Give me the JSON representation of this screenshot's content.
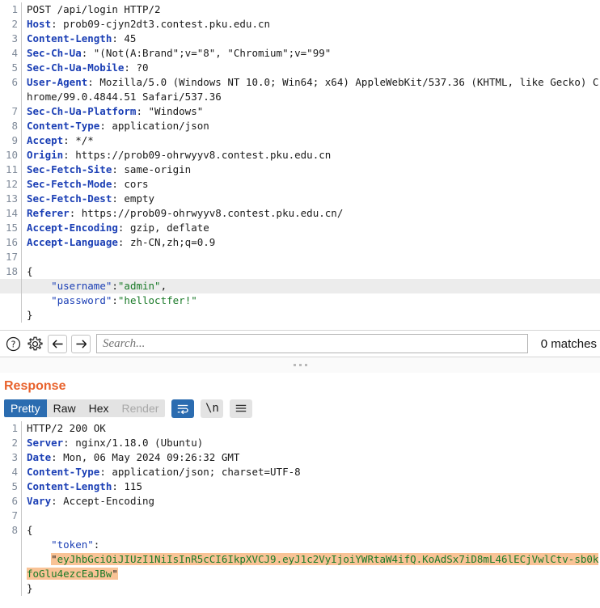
{
  "request": {
    "lines": [
      {
        "n": "1",
        "segments": [
          {
            "t": "POST /api/login HTTP/2",
            "c": "plain"
          }
        ]
      },
      {
        "n": "2",
        "segments": [
          {
            "t": "Host",
            "c": "hdr"
          },
          {
            "t": ": prob09-cjyn2dt3.contest.pku.edu.cn",
            "c": "plain"
          }
        ]
      },
      {
        "n": "3",
        "segments": [
          {
            "t": "Content-Length",
            "c": "hdr"
          },
          {
            "t": ": 45",
            "c": "plain"
          }
        ]
      },
      {
        "n": "4",
        "segments": [
          {
            "t": "Sec-Ch-Ua",
            "c": "hdr"
          },
          {
            "t": ": \"(Not(A:Brand\";v=\"8\", \"Chromium\";v=\"99\"",
            "c": "plain"
          }
        ]
      },
      {
        "n": "5",
        "segments": [
          {
            "t": "Sec-Ch-Ua-Mobile",
            "c": "hdr"
          },
          {
            "t": ": ?0",
            "c": "plain"
          }
        ]
      },
      {
        "n": "6",
        "segments": [
          {
            "t": "User-Agent",
            "c": "hdr"
          },
          {
            "t": ": Mozilla/5.0 (Windows NT 10.0; Win64; x64) AppleWebKit/537.36 (KHTML, like Gecko) Chrome/99.0.4844.51 Safari/537.36",
            "c": "plain"
          }
        ]
      },
      {
        "n": "7",
        "segments": [
          {
            "t": "Sec-Ch-Ua-Platform",
            "c": "hdr"
          },
          {
            "t": ": \"Windows\"",
            "c": "plain"
          }
        ]
      },
      {
        "n": "8",
        "segments": [
          {
            "t": "Content-Type",
            "c": "hdr"
          },
          {
            "t": ": application/json",
            "c": "plain"
          }
        ]
      },
      {
        "n": "9",
        "segments": [
          {
            "t": "Accept",
            "c": "hdr"
          },
          {
            "t": ": */*",
            "c": "plain"
          }
        ]
      },
      {
        "n": "10",
        "segments": [
          {
            "t": "Origin",
            "c": "hdr"
          },
          {
            "t": ": https://prob09-ohrwyyv8.contest.pku.edu.cn",
            "c": "plain"
          }
        ]
      },
      {
        "n": "11",
        "segments": [
          {
            "t": "Sec-Fetch-Site",
            "c": "hdr"
          },
          {
            "t": ": same-origin",
            "c": "plain"
          }
        ]
      },
      {
        "n": "12",
        "segments": [
          {
            "t": "Sec-Fetch-Mode",
            "c": "hdr"
          },
          {
            "t": ": cors",
            "c": "plain"
          }
        ]
      },
      {
        "n": "13",
        "segments": [
          {
            "t": "Sec-Fetch-Dest",
            "c": "hdr"
          },
          {
            "t": ": empty",
            "c": "plain"
          }
        ]
      },
      {
        "n": "14",
        "segments": [
          {
            "t": "Referer",
            "c": "hdr"
          },
          {
            "t": ": https://prob09-ohrwyyv8.contest.pku.edu.cn/",
            "c": "plain"
          }
        ]
      },
      {
        "n": "15",
        "segments": [
          {
            "t": "Accept-Encoding",
            "c": "hdr"
          },
          {
            "t": ": gzip, deflate",
            "c": "plain"
          }
        ]
      },
      {
        "n": "16",
        "segments": [
          {
            "t": "Accept-Language",
            "c": "hdr"
          },
          {
            "t": ": zh-CN,zh;q=0.9",
            "c": "plain"
          }
        ]
      },
      {
        "n": "17",
        "segments": [
          {
            "t": "",
            "c": "plain"
          }
        ]
      },
      {
        "n": "18",
        "segments": [
          {
            "t": "{",
            "c": "plain"
          }
        ]
      },
      {
        "n": "",
        "highlight": true,
        "segments": [
          {
            "t": "    ",
            "c": "plain"
          },
          {
            "t": "\"username\"",
            "c": "key"
          },
          {
            "t": ":",
            "c": "plain"
          },
          {
            "t": "\"admin\"",
            "c": "str"
          },
          {
            "t": ",",
            "c": "plain"
          }
        ]
      },
      {
        "n": "",
        "segments": [
          {
            "t": "    ",
            "c": "plain"
          },
          {
            "t": "\"password\"",
            "c": "key"
          },
          {
            "t": ":",
            "c": "plain"
          },
          {
            "t": "\"helloctfer!\"",
            "c": "str"
          }
        ]
      },
      {
        "n": "",
        "segments": [
          {
            "t": "}",
            "c": "plain"
          }
        ]
      }
    ]
  },
  "search": {
    "help_icon": "question-circle-icon",
    "settings_icon": "gear-icon",
    "prev_icon": "arrow-left-icon",
    "next_icon": "arrow-right-icon",
    "placeholder": "Search...",
    "value": "",
    "match_count": "0 matches"
  },
  "response": {
    "title": "Response",
    "tabs": [
      {
        "label": "Pretty",
        "state": "active"
      },
      {
        "label": "Raw",
        "state": "normal"
      },
      {
        "label": "Hex",
        "state": "normal"
      },
      {
        "label": "Render",
        "state": "disabled"
      }
    ],
    "wrap_button": {
      "icon": "word-wrap-icon",
      "active": true
    },
    "newline_button": {
      "label": "\\n",
      "icon": "newline-icon"
    },
    "menu_button": {
      "icon": "hamburger-menu-icon"
    },
    "lines": [
      {
        "n": "1",
        "segments": [
          {
            "t": "HTTP/2 200 OK",
            "c": "plain"
          }
        ]
      },
      {
        "n": "2",
        "segments": [
          {
            "t": "Server",
            "c": "hdr"
          },
          {
            "t": ": nginx/1.18.0 (Ubuntu)",
            "c": "plain"
          }
        ]
      },
      {
        "n": "3",
        "segments": [
          {
            "t": "Date",
            "c": "hdr"
          },
          {
            "t": ": Mon, 06 May 2024 09:26:32 GMT",
            "c": "plain"
          }
        ]
      },
      {
        "n": "4",
        "segments": [
          {
            "t": "Content-Type",
            "c": "hdr"
          },
          {
            "t": ": application/json; charset=UTF-8",
            "c": "plain"
          }
        ]
      },
      {
        "n": "5",
        "segments": [
          {
            "t": "Content-Length",
            "c": "hdr"
          },
          {
            "t": ": 115",
            "c": "plain"
          }
        ]
      },
      {
        "n": "6",
        "segments": [
          {
            "t": "Vary",
            "c": "hdr"
          },
          {
            "t": ": Accept-Encoding",
            "c": "plain"
          }
        ]
      },
      {
        "n": "7",
        "segments": [
          {
            "t": "",
            "c": "plain"
          }
        ]
      },
      {
        "n": "8",
        "segments": [
          {
            "t": "{",
            "c": "plain"
          }
        ]
      },
      {
        "n": "",
        "segments": [
          {
            "t": "    ",
            "c": "plain"
          },
          {
            "t": "\"token\"",
            "c": "key"
          },
          {
            "t": ":",
            "c": "plain"
          }
        ]
      },
      {
        "n": "",
        "segments": [
          {
            "t": "    ",
            "c": "plain"
          },
          {
            "t": "\"",
            "c": "plain mark"
          },
          {
            "t": "eyJhbGciOiJIUzI1NiIsInR5cCI6IkpXVCJ9.eyJ1c2VyIjoiYWRtaW4ifQ.KoAdSx7iD8mL46lECjVwlCtv-sb0kfoGlu4ezcEaJBw",
            "c": "str mark"
          },
          {
            "t": "\"",
            "c": "plain mark"
          }
        ]
      },
      {
        "n": "",
        "segments": [
          {
            "t": "}",
            "c": "plain"
          }
        ]
      }
    ],
    "token_value": "eyJhbGciOiJIUzI1NiIsInR5cCI6IkpXVCJ9.eyJ1c2VyIjoiYWRtaW4ifQ.KoAdSx7iD8mL46lECjVwlCtv-sb0kfoGlu4ezcEaJBw"
  },
  "colors": {
    "accent_orange": "#e8622c",
    "header_blue": "#1b3fb5",
    "string_green": "#1a7a28",
    "tab_active_blue": "#2b6cb0",
    "highlight_orange": "#f9c396",
    "row_highlight_grey": "#ececec"
  }
}
